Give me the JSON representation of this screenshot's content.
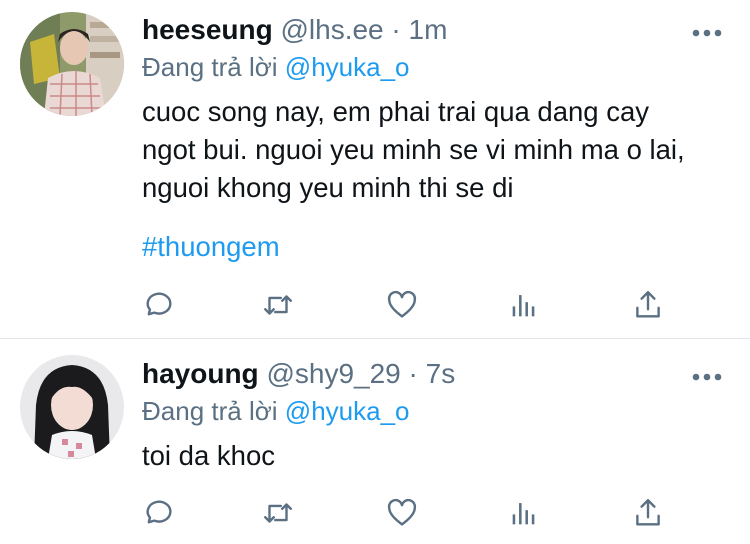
{
  "tweets": [
    {
      "display_name": "heeseung",
      "handle": "@lhs.ee",
      "separator": "·",
      "time": "1m",
      "reply_prefix": "Đang trả lời",
      "reply_to": "@hyuka_o",
      "text": "cuoc song nay, em phai trai qua dang cay ngot bui. nguoi yeu minh se vi minh ma o lai, nguoi khong yeu minh thi se di",
      "hashtag": "#thuongem",
      "more_icon": "more-horizontal-icon",
      "actions": [
        "reply-icon",
        "retweet-icon",
        "like-icon",
        "analytics-icon",
        "share-icon"
      ]
    },
    {
      "display_name": "hayoung",
      "handle": "@shy9_29",
      "separator": "·",
      "time": "7s",
      "reply_prefix": "Đang trả lời",
      "reply_to": "@hyuka_o",
      "text": "toi da khoc",
      "more_icon": "more-horizontal-icon",
      "actions": [
        "reply-icon",
        "retweet-icon",
        "like-icon",
        "analytics-icon",
        "share-icon"
      ]
    }
  ],
  "colors": {
    "link": "#1d9bf0",
    "secondary_text": "#5b7083",
    "primary_text": "#0f1419",
    "divider": "#e1e6ea"
  }
}
